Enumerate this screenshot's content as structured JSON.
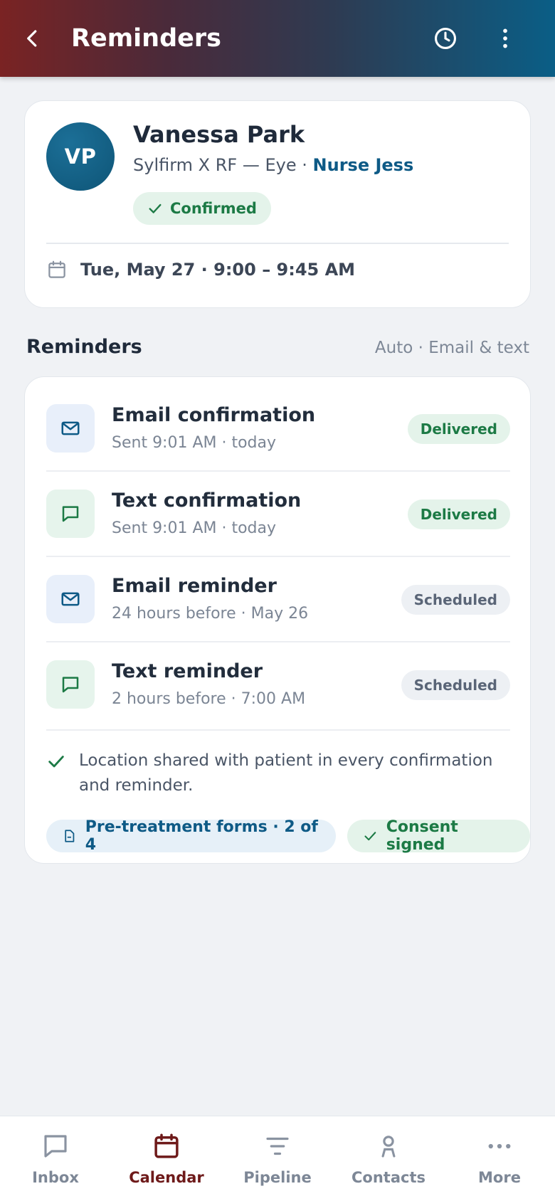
{
  "header": {
    "title": "Reminders",
    "back_icon": "chevron-left-icon",
    "history_icon": "clock-icon",
    "more_icon": "vertical-dots-icon"
  },
  "patient": {
    "initials": "VP",
    "name": "Vanessa Park",
    "treatment": "Sylfirm X RF — Eye",
    "separator": "·",
    "provider": "Nurse Jess",
    "status": "Confirmed",
    "appointment": "Tue, May 27 · 9:00 – 9:45 AM"
  },
  "section": {
    "title": "Reminders",
    "meta": "Auto · Email & text"
  },
  "reminders": [
    {
      "type": "email",
      "title": "Email confirmation",
      "sub": "Sent 9:01 AM · today",
      "status": "Delivered"
    },
    {
      "type": "text",
      "title": "Text confirmation",
      "sub": "Sent 9:01 AM · today",
      "status": "Delivered"
    },
    {
      "type": "email",
      "title": "Email reminder",
      "sub": "24 hours before · May 26",
      "status": "Scheduled"
    },
    {
      "type": "text",
      "title": "Text reminder",
      "sub": "2 hours before · 7:00 AM",
      "status": "Scheduled"
    }
  ],
  "location_note": "Location shared with patient in every confirmation and reminder.",
  "chips": {
    "forms": "Pre-treatment forms · 2 of 4",
    "consent": "Consent signed"
  },
  "nav": [
    {
      "label": "Inbox",
      "icon": "chat-bubble-icon",
      "active": false
    },
    {
      "label": "Calendar",
      "icon": "calendar-icon",
      "active": true
    },
    {
      "label": "Pipeline",
      "icon": "filter-lines-icon",
      "active": false
    },
    {
      "label": "Contacts",
      "icon": "person-icon",
      "active": false
    },
    {
      "label": "More",
      "icon": "horizontal-dots-icon",
      "active": false
    }
  ],
  "colors": {
    "brand_teal": "#0e5a86",
    "brand_maroon": "#7a2323",
    "success_green": "#1c7a45"
  }
}
